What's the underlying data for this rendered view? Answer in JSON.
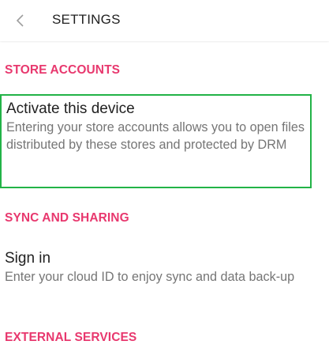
{
  "header": {
    "back_icon": "chevron-left-icon",
    "title": "SETTINGS"
  },
  "colors": {
    "accent": "#e8386e",
    "highlight_border": "#22b347",
    "secondary_text": "#757575"
  },
  "sections": [
    {
      "label": "STORE ACCOUNTS",
      "item": {
        "title": "Activate this device",
        "subtitle": "Entering your store accounts allows you to open files distributed by these stores and protected by DRM"
      }
    },
    {
      "label": "SYNC AND SHARING",
      "item": {
        "title": "Sign in",
        "subtitle": "Enter your cloud ID to enjoy sync and data back-up"
      }
    },
    {
      "label": "EXTERNAL SERVICES"
    }
  ]
}
